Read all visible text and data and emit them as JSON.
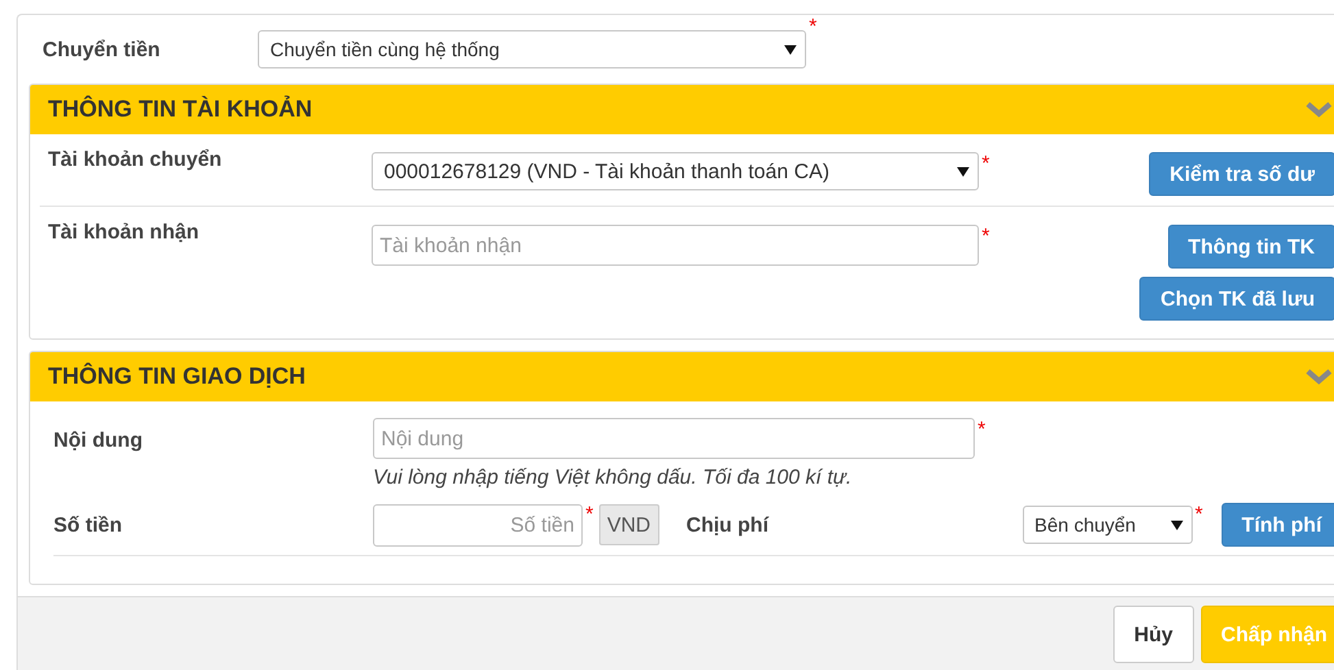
{
  "transfer_type": {
    "label": "Chuyển tiền",
    "value": "Chuyển tiền cùng hệ thống",
    "required": "*"
  },
  "account_section": {
    "title": "THÔNG TIN TÀI KHOẢN",
    "expanded": true,
    "rows": [
      {
        "label": "Tài khoản chuyển",
        "field": {
          "kind": "select",
          "value": "000012678129 (VND - Tài khoản thanh toán CA)"
        },
        "required": "*",
        "buttons": [
          "Kiểm tra số dư"
        ]
      },
      {
        "label": "Tài khoản nhận",
        "field": {
          "kind": "input",
          "placeholder": "Tài khoản nhận"
        },
        "required": "*",
        "buttons": [
          "Thông tin TK",
          "Chọn TK đã lưu"
        ]
      }
    ]
  },
  "transaction_section": {
    "title": "THÔNG TIN GIAO DỊCH",
    "expanded": true,
    "content": {
      "label": "Nội dung",
      "placeholder": "Nội dung",
      "required": "*",
      "hint": "Vui lòng nhập tiếng Việt không dấu. Tối đa 100 kí tự."
    },
    "amount": {
      "label": "Số tiền",
      "placeholder": "Số tiền",
      "required": "*",
      "currency": "VND"
    },
    "fee": {
      "label": "Chịu phí",
      "value": "Bên chuyển",
      "required": "*",
      "button": "Tính phí"
    }
  },
  "footer_buttons": [
    {
      "label": "Hủy",
      "kind": "secondary"
    },
    {
      "label": "Chấp nhận",
      "kind": "primary"
    }
  ]
}
